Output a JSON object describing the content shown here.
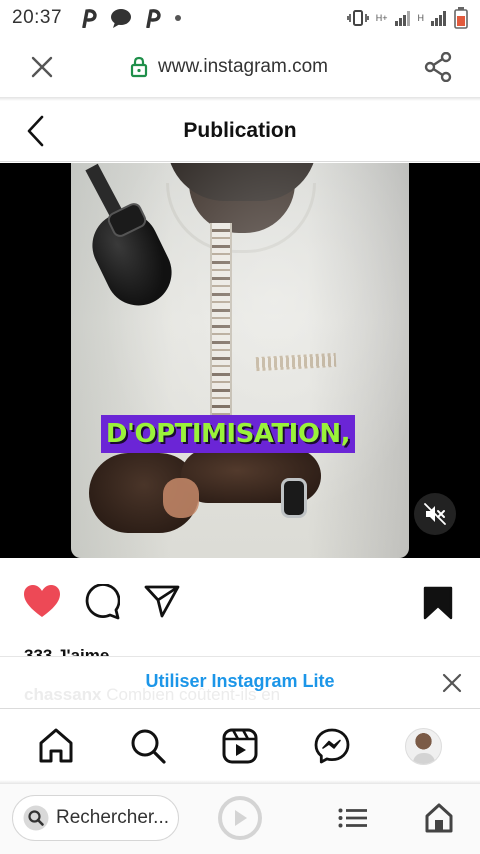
{
  "status_bar": {
    "time": "20:37",
    "network_1": "H+",
    "network_2": "H"
  },
  "browser": {
    "url": "www.instagram.com",
    "search_placeholder": "Rechercher..."
  },
  "page": {
    "title": "Publication"
  },
  "post": {
    "caption_overlay": "D'OPTIMISATION,",
    "likes": "333 J'aime",
    "username": "chassanx",
    "caption_partial": "Combien coûtent-ils en"
  },
  "banner": {
    "label": "Utiliser Instagram Lite"
  },
  "colors": {
    "like_red": "#ed4956",
    "link_blue": "#1c96e8",
    "caption_purple": "#6b25d6",
    "caption_green": "#9af23a"
  },
  "icons": [
    "close-icon",
    "lock-icon",
    "share-icon",
    "back-icon",
    "heart-icon",
    "comment-icon",
    "send-icon",
    "bookmark-icon",
    "mute-icon",
    "home-icon",
    "search-icon",
    "reels-icon",
    "messenger-icon",
    "play-icon",
    "menu-icon"
  ]
}
